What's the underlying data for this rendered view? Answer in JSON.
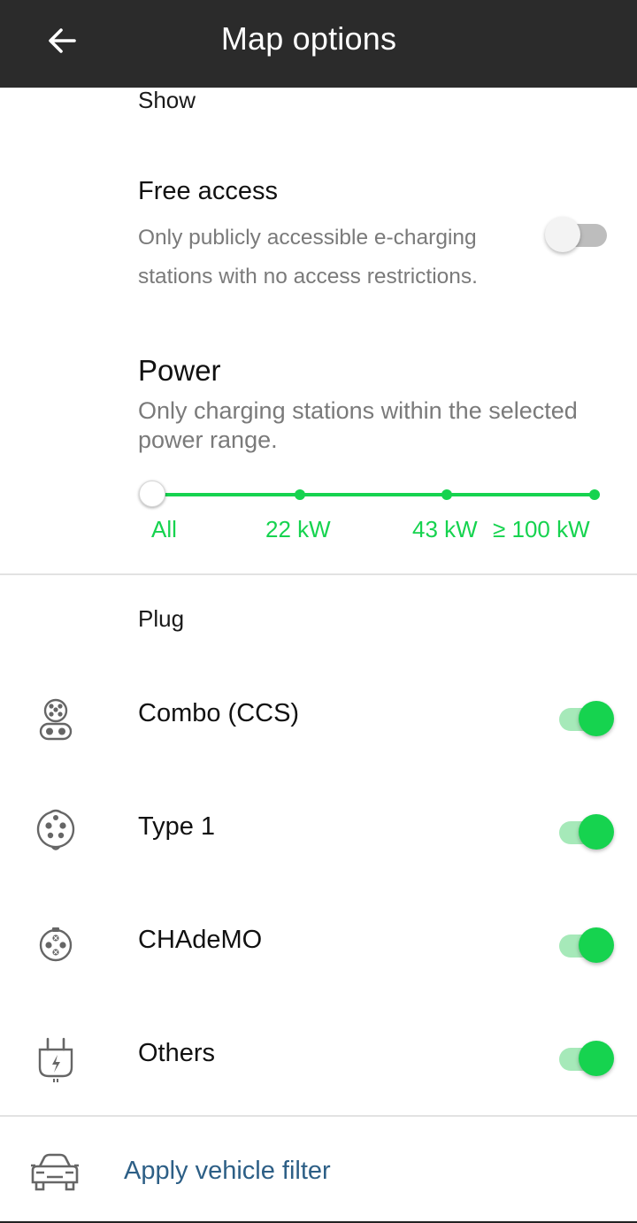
{
  "header": {
    "title": "Map options",
    "back_icon": "arrow-left-icon"
  },
  "show_section": {
    "label": "Show",
    "free_access": {
      "title": "Free access",
      "description_line1": "Only publicly accessible e-charging",
      "description_line2": "stations with no access restrictions.",
      "enabled": false
    },
    "power": {
      "title": "Power",
      "description_line1": "Only charging stations within the selected",
      "description_line2": "power range.",
      "ticks": [
        "All",
        "22 kW",
        "43 kW",
        "≥ 100 kW"
      ],
      "selected": "All"
    }
  },
  "plug_section": {
    "label": "Plug",
    "items": [
      {
        "label": "Combo (CCS)",
        "icon": "ccs-plug-icon",
        "enabled": true
      },
      {
        "label": "Type 1",
        "icon": "type1-plug-icon",
        "enabled": true
      },
      {
        "label": "CHAdeMO",
        "icon": "chademo-plug-icon",
        "enabled": true
      },
      {
        "label": "Others",
        "icon": "other-plug-icon",
        "enabled": true
      }
    ]
  },
  "apply_vehicle_filter": {
    "label": "Apply vehicle filter",
    "icon": "car-icon"
  },
  "colors": {
    "accent_green": "#16d34f",
    "header_bg": "#2b2b2b",
    "link_blue": "#2d5f86"
  }
}
